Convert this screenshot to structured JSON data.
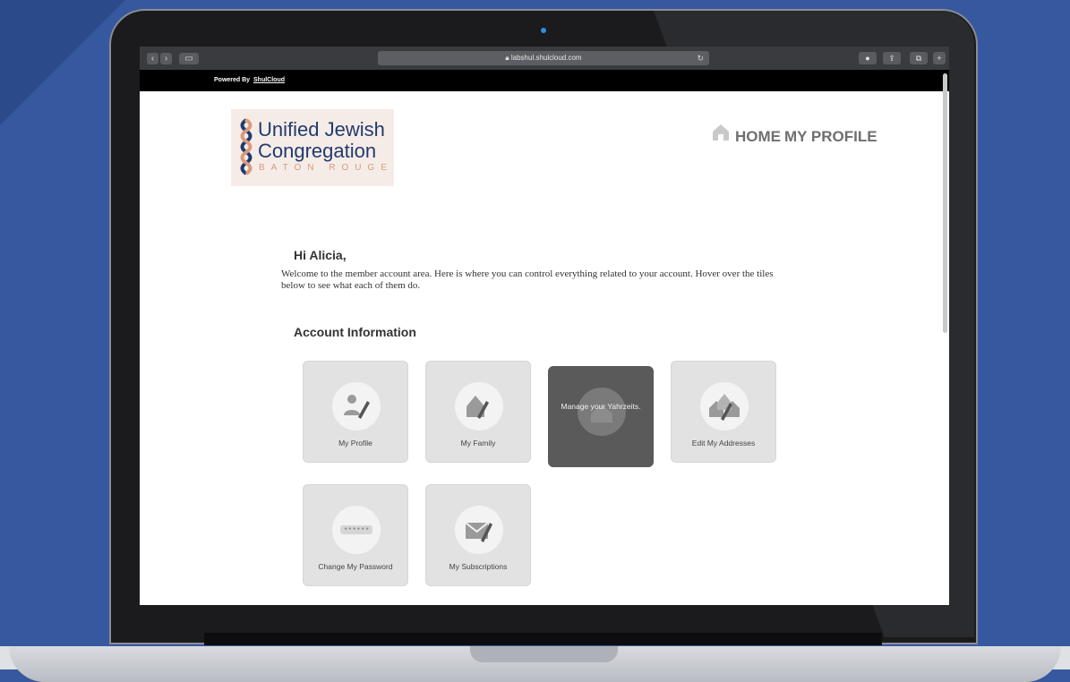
{
  "browser": {
    "url": "labshul.shulcloud.com",
    "powered_by_label": "Powered By",
    "powered_by_link": "ShulCloud"
  },
  "logo": {
    "line1": "Unified Jewish",
    "line2": "Congregation",
    "line3": "BATON ROUGE"
  },
  "nav": {
    "home_label": "HOME",
    "profile_label": "MY PROFILE"
  },
  "content": {
    "greeting": "Hi Alicia,",
    "welcome": "Welcome to the member account area. Here is where you can control everything related to your account. Hover over the tiles below to see what each of them do.",
    "section_title": "Account Information"
  },
  "tiles": [
    {
      "label": "My Profile",
      "icon": "profile-edit-icon"
    },
    {
      "label": "My Family",
      "icon": "family-home-edit-icon"
    },
    {
      "label": "Manage your Yahrzeits.",
      "icon": "yahrzeit-icon",
      "state": "hover"
    },
    {
      "label": "Edit My Addresses",
      "icon": "addresses-edit-icon"
    },
    {
      "label": "Change My Password",
      "icon": "password-icon"
    },
    {
      "label": "My Subscriptions",
      "icon": "subscriptions-edit-icon"
    }
  ],
  "colors": {
    "page_bg": "#2c4a8e",
    "tile_bg": "#e2e2e2",
    "tile_hover_bg": "#5a5a5a",
    "logo_navy": "#1f3b6e",
    "logo_peach": "#d99a7e"
  }
}
